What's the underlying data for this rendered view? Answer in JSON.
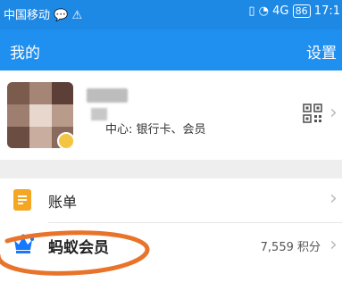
{
  "status_bar": {
    "carrier": "中国移动",
    "signal_text": "4G",
    "battery": "86",
    "time": "17:1"
  },
  "header": {
    "title": "我的",
    "settings_label": "设置"
  },
  "profile": {
    "center_text": "中心: 银行卡、会员",
    "qr_icon": "qr-code-icon"
  },
  "menu": {
    "bill": {
      "label": "账单",
      "icon": "bill-icon"
    },
    "membership": {
      "label": "蚂蚁会员",
      "points": "7,559 积分",
      "icon": "crown-icon"
    }
  },
  "colors": {
    "status_bar": "#1e88e5",
    "header": "#1f8ff0",
    "bill_icon": "#f5a623",
    "crown_icon": "#1677ff",
    "annotation": "#e8742c"
  }
}
